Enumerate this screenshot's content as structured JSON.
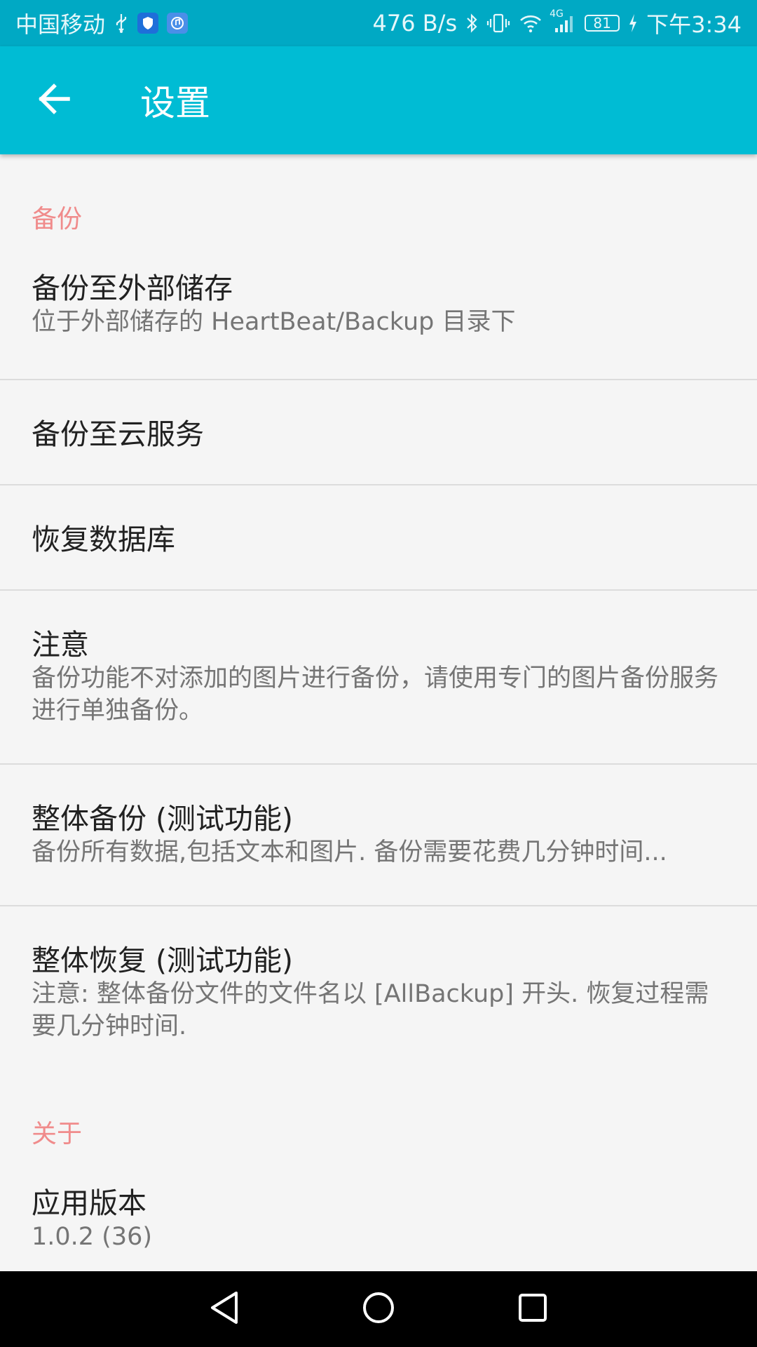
{
  "status_bar": {
    "carrier": "中国移动",
    "net_speed": "476 B/s",
    "battery_level": "81",
    "time": "下午3:34",
    "network_type": "4G"
  },
  "app_bar": {
    "title": "设置",
    "color": "#00bcd4"
  },
  "sections": {
    "backup": {
      "header": "备份",
      "items": [
        {
          "title": "备份至外部储存",
          "summary": "位于外部储存的 HeartBeat/Backup 目录下"
        },
        {
          "title": "备份至云服务"
        },
        {
          "title": "恢复数据库"
        },
        {
          "title": "注意",
          "summary": "备份功能不对添加的图片进行备份，请使用专门的图片备份服务进行单独备份。"
        },
        {
          "title": "整体备份 (测试功能)",
          "summary": "备份所有数据,包括文本和图片. 备份需要花费几分钟时间..."
        },
        {
          "title": "整体恢复 (测试功能)",
          "summary": "注意: 整体备份文件的文件名以 [AllBackup] 开头. 恢复过程需要几分钟时间."
        }
      ]
    },
    "about": {
      "header": "关于",
      "items": [
        {
          "title": "应用版本",
          "summary": "1.0.2 (36)"
        }
      ]
    }
  },
  "icons": {
    "back": "arrow-left-icon",
    "nav_back": "triangle-back-icon",
    "nav_home": "circle-home-icon",
    "nav_recents": "square-recents-icon"
  },
  "colors": {
    "section_header": "#f08b8b",
    "status_bar": "#00a9c4"
  }
}
